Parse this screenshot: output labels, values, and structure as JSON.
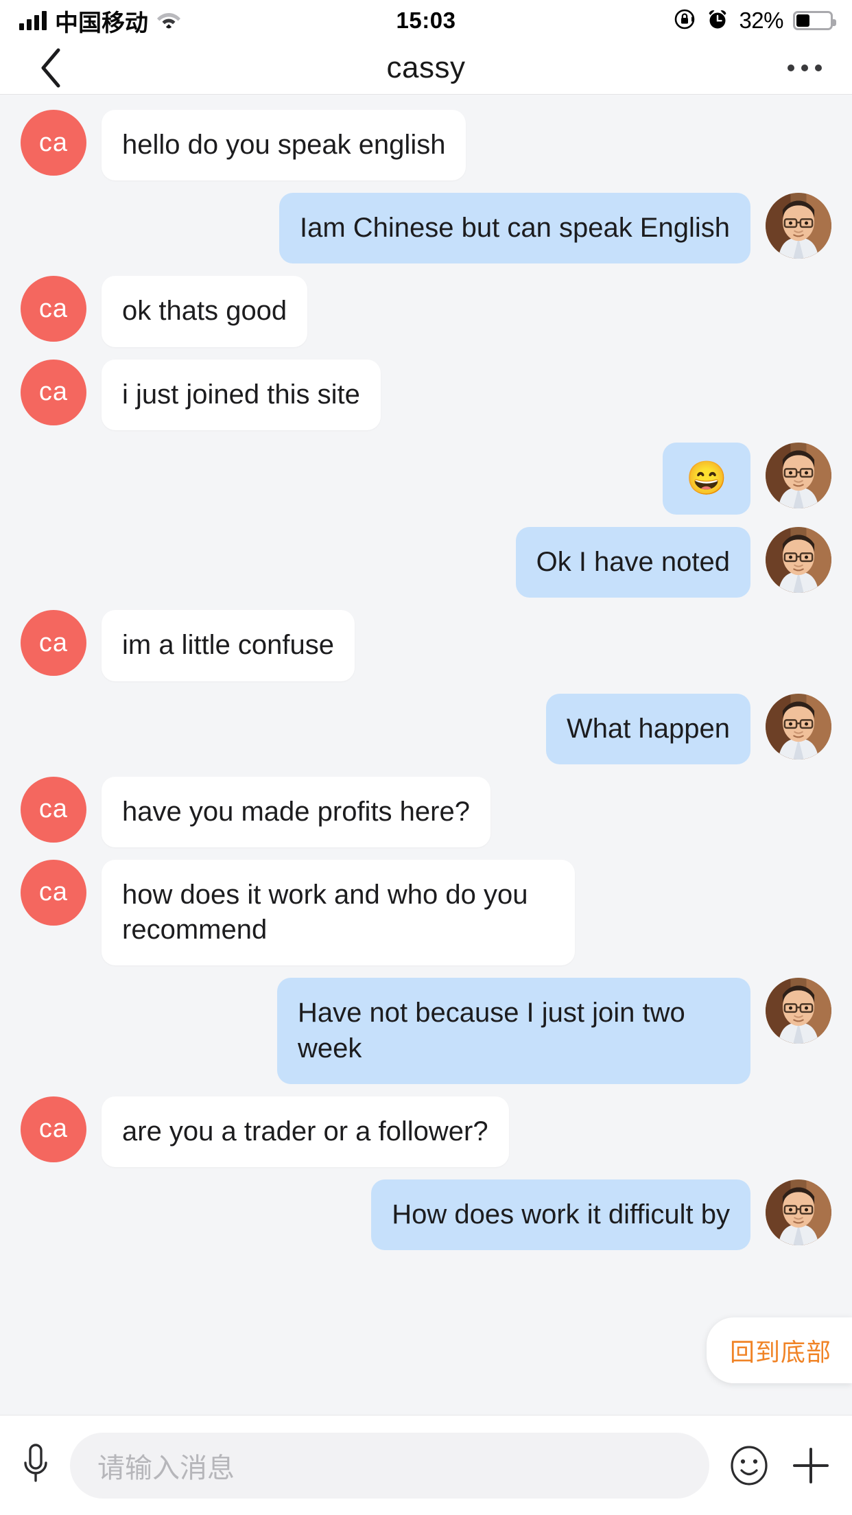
{
  "statusbar": {
    "carrier": "中国移动",
    "time": "15:03",
    "battery_percent": "32%",
    "battery_level": 40,
    "icons": [
      "signal-bars-icon",
      "wifi-icon",
      "rotation-lock-icon",
      "alarm-clock-icon",
      "battery-icon"
    ]
  },
  "navbar": {
    "back_label": "back-chevron",
    "title": "cassy",
    "more_label": "more-options"
  },
  "peer": {
    "avatar_initials": "ca",
    "avatar_color": "#f4675f"
  },
  "me": {
    "avatar_type": "photo"
  },
  "colors": {
    "incoming_bubble": "#ffffff",
    "outgoing_bubble": "#c6e0fb",
    "chat_background": "#f4f5f7",
    "accent_orange": "#f08326",
    "peer_avatar": "#f4675f"
  },
  "messages": [
    {
      "side": "in",
      "text": "hello do you speak english"
    },
    {
      "side": "out",
      "text": "Iam Chinese but can speak English"
    },
    {
      "side": "in",
      "text": "ok thats good"
    },
    {
      "side": "in",
      "text": "i just joined this site"
    },
    {
      "side": "out",
      "text": "😄",
      "emoji": true
    },
    {
      "side": "out",
      "text": "Ok I have noted"
    },
    {
      "side": "in",
      "text": "im a little confuse"
    },
    {
      "side": "out",
      "text": "What happen"
    },
    {
      "side": "in",
      "text": "have you made profits here?"
    },
    {
      "side": "in",
      "text": "how does it work and who do you recommend"
    },
    {
      "side": "out",
      "text": "Have not because I just join two week"
    },
    {
      "side": "in",
      "text": "are you a trader or a follower?"
    },
    {
      "side": "out",
      "text": "How does work it difficult by"
    }
  ],
  "overlay": {
    "back_to_bottom": "回到底部"
  },
  "inputbar": {
    "placeholder": "请输入消息",
    "value": "",
    "icons": [
      "microphone-icon",
      "emoji-icon",
      "plus-icon"
    ]
  }
}
